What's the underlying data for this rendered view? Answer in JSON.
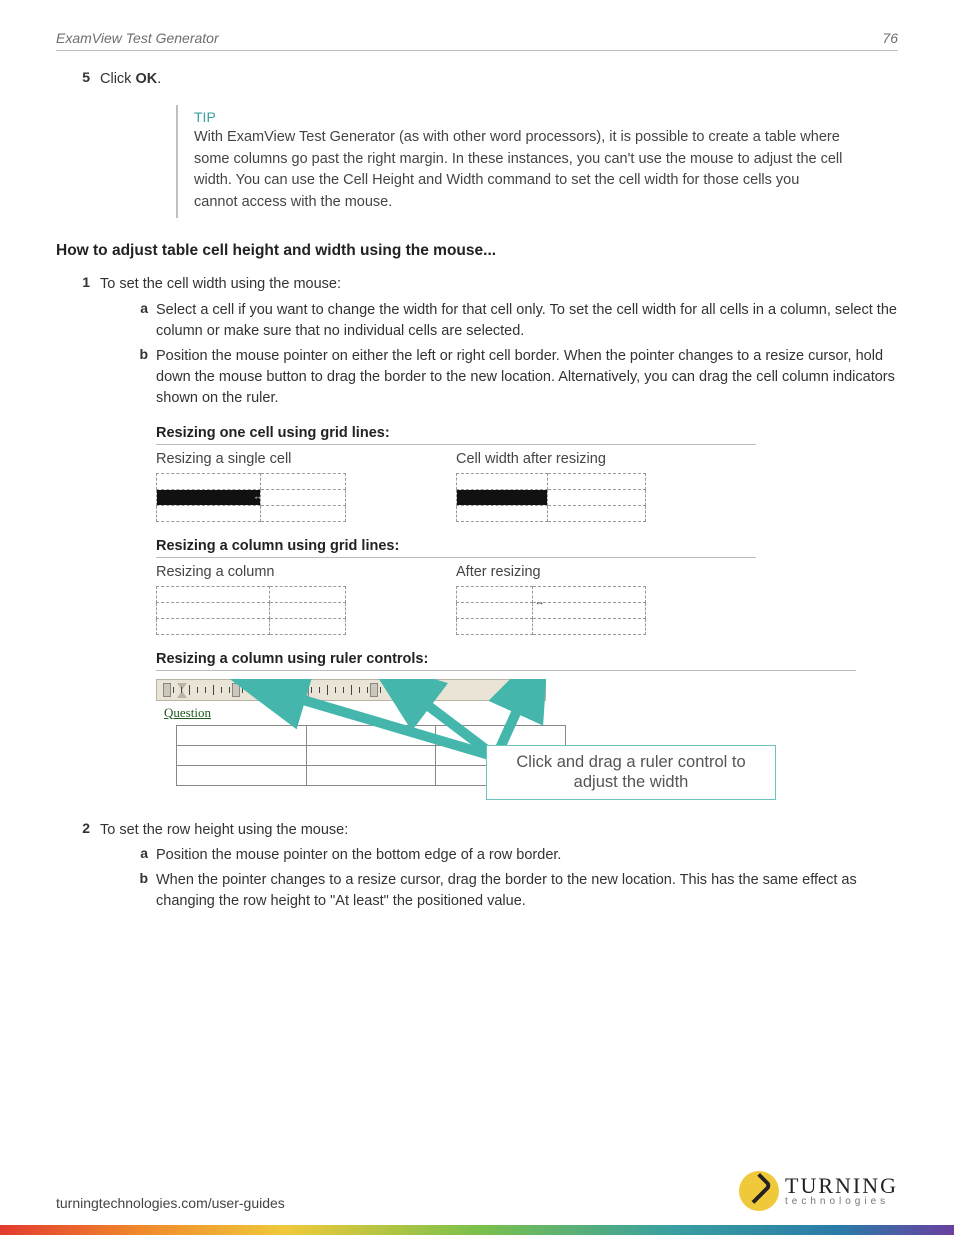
{
  "header": {
    "title": "ExamView Test Generator",
    "page_number": "76"
  },
  "step5": {
    "num": "5",
    "pre": "Click ",
    "bold": "OK",
    "post": "."
  },
  "tip": {
    "label": "TIP",
    "text": "With ExamView Test Generator (as with other word processors), it is possible to create a table where some columns go past the right margin. In these instances, you can't use the mouse to adjust the cell width. You can use the Cell Height and Width command to set the cell width for those cells you cannot access with the mouse."
  },
  "section_heading": "How to adjust table cell height and width using the mouse...",
  "step1": {
    "num": "1",
    "text": "To set the cell width using the mouse:",
    "a": {
      "letter": "a",
      "text": "Select a cell if you want to change the width for that cell only. To set the cell width for all cells in a column, select the column or make sure that no individual cells are selected."
    },
    "b": {
      "letter": "b",
      "text": "Position the mouse pointer on either the left or right cell border. When the pointer changes to a resize cursor, hold down the mouse button to drag the border to the new location. Alternatively, you can drag the cell column indicators shown on the ruler."
    }
  },
  "fig1": {
    "heading": "Resizing one cell using grid lines:",
    "left_caption": "Resizing a single cell",
    "right_caption": "Cell width after resizing"
  },
  "fig2": {
    "heading": "Resizing a column using grid lines:",
    "left_caption": "Resizing a column",
    "right_caption": "After resizing"
  },
  "fig3": {
    "heading": "Resizing a column using ruler controls:",
    "question_label": "Question",
    "callout": "Click and drag a ruler control to adjust the width"
  },
  "step2": {
    "num": "2",
    "text": "To set the row height using the mouse:",
    "a": {
      "letter": "a",
      "text": "Position the mouse pointer on the bottom edge of a row border."
    },
    "b": {
      "letter": "b",
      "text": "When the pointer changes to a resize cursor, drag the border to the new location. This has the same effect as changing the row height to \"At least\" the positioned value."
    }
  },
  "footer": {
    "url": "turningtechnologies.com/user-guides",
    "brand_top": "TURNING",
    "brand_bottom": "technologies"
  }
}
